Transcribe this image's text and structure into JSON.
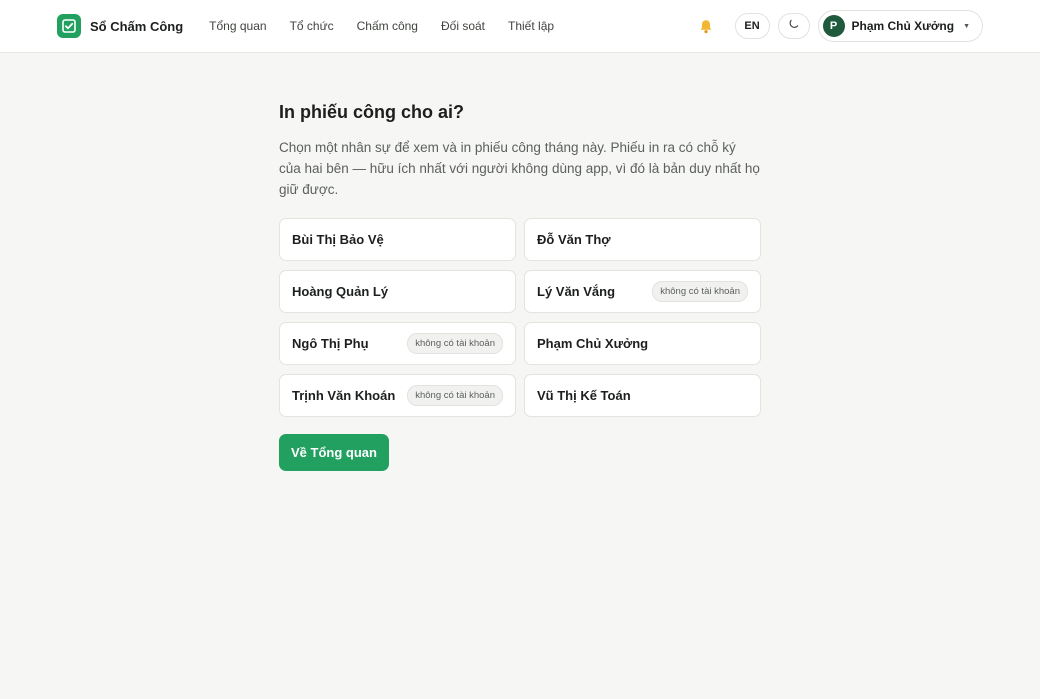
{
  "app": {
    "name": "Sổ Chấm Công"
  },
  "nav": {
    "items": [
      {
        "label": "Tổng quan"
      },
      {
        "label": "Tổ chức"
      },
      {
        "label": "Chấm công"
      },
      {
        "label": "Đối soát"
      },
      {
        "label": "Thiết lập"
      }
    ]
  },
  "header": {
    "lang_label": "EN",
    "user": {
      "initial": "P",
      "name": "Phạm Chủ Xưởng"
    }
  },
  "page": {
    "title": "In phiếu công cho ai?",
    "description": "Chọn một nhân sự để xem và in phiếu công tháng này. Phiếu in ra có chỗ ký của hai bên — hữu ích nhất với người không dùng app, vì đó là bản duy nhất họ giữ được.",
    "no_account_badge": "không có tài khoản",
    "back_button": "Về Tổng quan"
  },
  "people": [
    {
      "name": "Bùi Thị Bảo Vệ",
      "badge": ""
    },
    {
      "name": "Đỗ Văn Thợ",
      "badge": ""
    },
    {
      "name": "Hoàng Quản Lý",
      "badge": ""
    },
    {
      "name": "Lý Văn Vắng",
      "badge": "không có tài khoản"
    },
    {
      "name": "Ngô Thị Phụ",
      "badge": "không có tài khoản"
    },
    {
      "name": "Phạm Chủ Xưởng",
      "badge": ""
    },
    {
      "name": "Trịnh Văn Khoán",
      "badge": "không có tài khoản"
    },
    {
      "name": "Vũ Thị Kế Toán",
      "badge": ""
    }
  ],
  "colors": {
    "accent": "#22a060",
    "avatar_bg": "#1f5a3c",
    "bell": "#f2b632"
  },
  "icons": {
    "logo": "check-square-icon",
    "bell": "bell-icon",
    "theme": "moon-icon",
    "caret": "caret-down-icon"
  }
}
